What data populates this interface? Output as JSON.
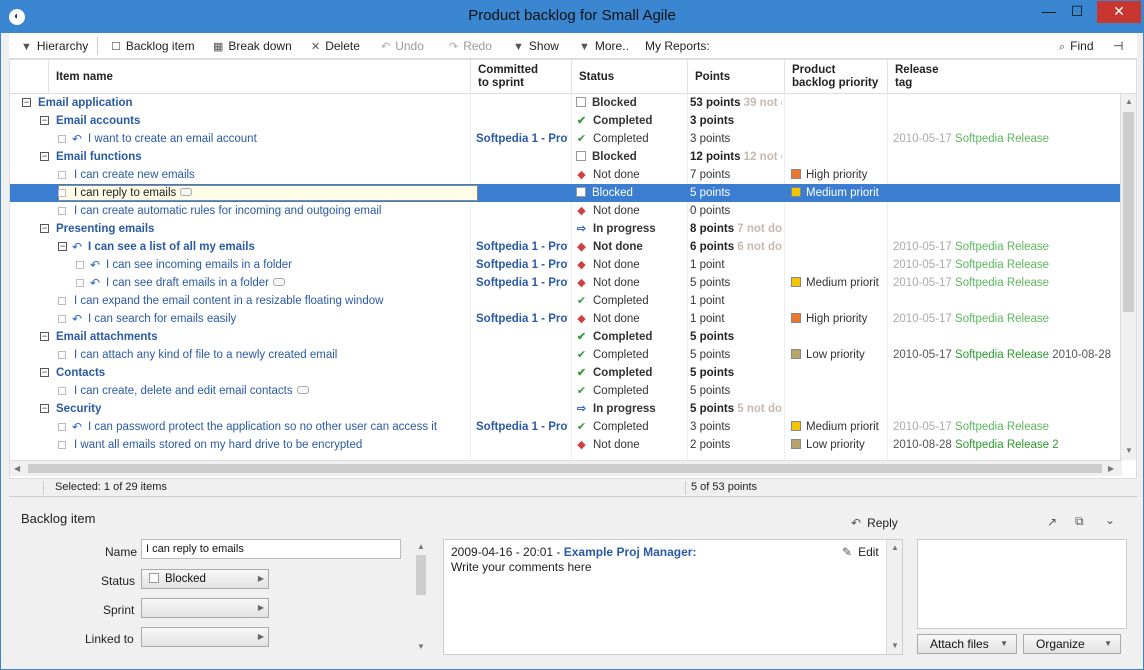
{
  "window": {
    "title": "Product backlog for Small Agile",
    "minimize": "—",
    "maximize": "☐",
    "close": "✕"
  },
  "toolbar": {
    "hierarchy": "Hierarchy",
    "backlog_item": "Backlog item",
    "break_down": "Break down",
    "delete": "Delete",
    "undo": "Undo",
    "redo": "Redo",
    "show": "Show",
    "more": "More..",
    "my_reports": "My Reports:",
    "find": "Find"
  },
  "columns": {
    "item_name": "Item name",
    "committed": "Committed\nto sprint",
    "status": "Status",
    "points": "Points",
    "priority": "Product\nbacklog priority",
    "release": "Release\ntag"
  },
  "rows": [
    {
      "level": 0,
      "group": true,
      "name": "Email application",
      "status": "Blocked",
      "points": "53 points",
      "points_extra": "39 not d"
    },
    {
      "level": 1,
      "group": true,
      "name": "Email accounts",
      "status": "Completed",
      "points": "3 points"
    },
    {
      "level": 2,
      "group": false,
      "sprint_icon": true,
      "name": "I want to create an email account",
      "sprint": "Softpedia 1 - Prot",
      "status": "Completed",
      "points": "3 points",
      "rel_date": "2010-05-17",
      "rel_name": "Softpedia Release"
    },
    {
      "level": 1,
      "group": true,
      "name": "Email functions",
      "status": "Blocked",
      "points": "12 points",
      "points_extra": "12 not d"
    },
    {
      "level": 2,
      "group": false,
      "name": "I can create new emails",
      "status": "Not done",
      "points": "7 points",
      "priority": "High priority"
    },
    {
      "level": 2,
      "group": false,
      "name": "I can reply to emails",
      "comment": true,
      "status": "Blocked",
      "points": "5 points",
      "priority": "Medium priorit",
      "selected": true
    },
    {
      "level": 2,
      "group": false,
      "name": "I can create automatic rules for incoming and outgoing email",
      "status": "Not done",
      "points": "0 points"
    },
    {
      "level": 1,
      "group": true,
      "name": "Presenting emails",
      "status": "In progress",
      "points": "8 points",
      "points_extra": "7 not do"
    },
    {
      "level": 2,
      "group": true,
      "sprint_icon": true,
      "name": "I can see a list of all my emails",
      "sprint": "Softpedia 1 - Prot",
      "status": "Not done",
      "points": "6 points",
      "points_extra": "6 not do",
      "rel_date": "2010-05-17",
      "rel_name": "Softpedia Release"
    },
    {
      "level": 3,
      "group": false,
      "sprint_icon": true,
      "name": "I can see incoming emails in a folder",
      "sprint": "Softpedia 1 - Prot",
      "status": "Not done",
      "points": "1 point",
      "rel_date": "2010-05-17",
      "rel_name": "Softpedia Release"
    },
    {
      "level": 3,
      "group": false,
      "sprint_icon": true,
      "name": "I can see draft emails in a folder",
      "comment": true,
      "sprint": "Softpedia 1 - Prot",
      "status": "Not done",
      "points": "5 points",
      "priority": "Medium priorit",
      "rel_date": "2010-05-17",
      "rel_name": "Softpedia Release"
    },
    {
      "level": 2,
      "group": false,
      "name": "I can expand the email content in a resizable floating window",
      "status": "Completed",
      "points": "1 point"
    },
    {
      "level": 2,
      "group": false,
      "sprint_icon": true,
      "name": "I can search for emails easily",
      "sprint": "Softpedia 1 - Prot",
      "status": "Not done",
      "points": "1 point",
      "priority": "High priority",
      "rel_date": "2010-05-17",
      "rel_name": "Softpedia Release"
    },
    {
      "level": 1,
      "group": true,
      "name": "Email attachments",
      "status": "Completed",
      "points": "5 points"
    },
    {
      "level": 2,
      "group": false,
      "name": "I can attach any kind of file to a newly created email",
      "status": "Completed",
      "points": "5 points",
      "priority": "Low priority",
      "rel_date": "2010-05-17",
      "rel_name": "Softpedia Release",
      "rel_strong": true,
      "rel_extra": "2010-08-28"
    },
    {
      "level": 1,
      "group": true,
      "name": "Contacts",
      "status": "Completed",
      "points": "5 points"
    },
    {
      "level": 2,
      "group": false,
      "name": "I can create, delete and edit email contacts",
      "comment": true,
      "status": "Completed",
      "points": "5 points"
    },
    {
      "level": 1,
      "group": true,
      "name": "Security",
      "status": "In progress",
      "points": "5 points",
      "points_extra": "5 not do"
    },
    {
      "level": 2,
      "group": false,
      "sprint_icon": true,
      "name": "I can password protect the application so no other user can access it",
      "sprint": "Softpedia 1 - Prot",
      "status": "Completed",
      "points": "3 points",
      "priority": "Medium priorit",
      "rel_date": "2010-05-17",
      "rel_name": "Softpedia Release"
    },
    {
      "level": 2,
      "group": false,
      "name": "I want all emails stored on my hard drive to be encrypted",
      "status": "Not done",
      "points": "2 points",
      "priority": "Low priority",
      "rel_date": "2010-08-28",
      "rel_name": "Softpedia Release 2",
      "rel_strong": true
    }
  ],
  "colors": {
    "completed": "#3a9a3a",
    "not_done": "#d04040",
    "in_progress": "#2a5fc0",
    "high": "#e8762b",
    "medium": "#f2c600",
    "low": "#b8a46a",
    "selection": "#3a7dd1"
  },
  "statusbar": {
    "selected": "Selected: 1 of 29 items",
    "points": "5 of 53 points"
  },
  "detail": {
    "section_title": "Backlog item",
    "reply": "Reply",
    "name_label": "Name",
    "name_value": "I can reply to emails",
    "status_label": "Status",
    "status_value": "Blocked",
    "sprint_label": "Sprint",
    "sprint_value": "",
    "linked_label": "Linked to",
    "linked_value": "",
    "comment_meta": "2009-04-16 - 20:01 - ",
    "comment_author": "Example Proj Manager:",
    "comment_edit": "Edit",
    "comment_placeholder": "Write your comments here",
    "attach_files": "Attach files",
    "organize": "Organize"
  }
}
